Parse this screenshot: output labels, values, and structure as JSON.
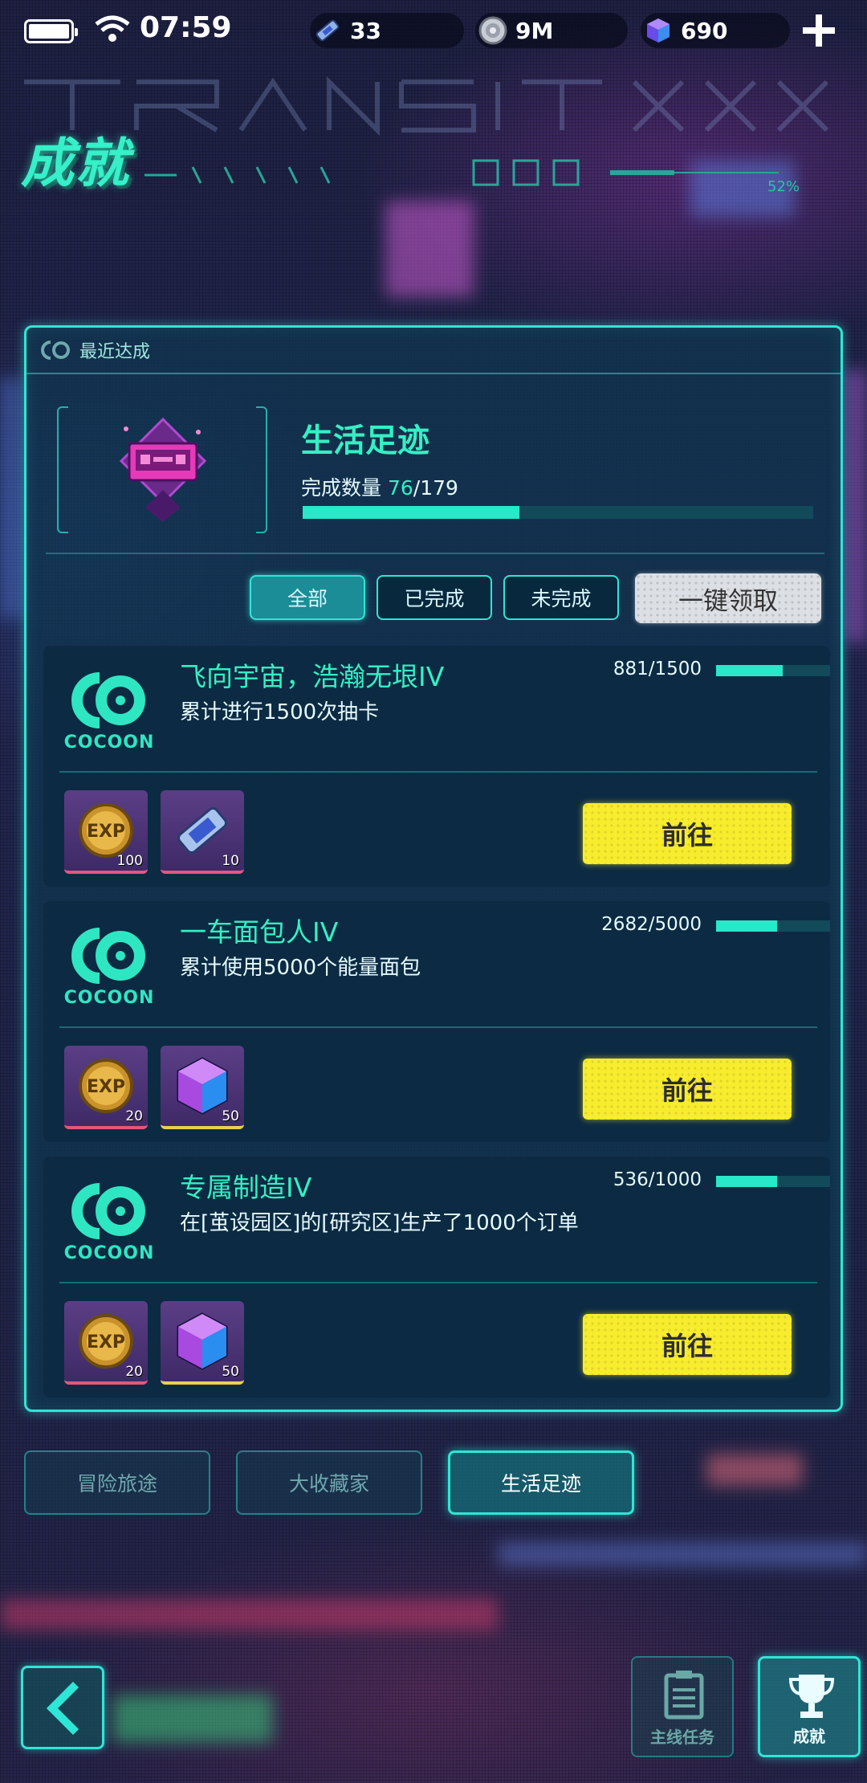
{
  "status": {
    "time": "07:59"
  },
  "resources": [
    {
      "icon": "ticket-icon",
      "value": "33"
    },
    {
      "icon": "coin-disc-icon",
      "value": "9M"
    },
    {
      "icon": "gem-cube-icon",
      "value": "690"
    }
  ],
  "header": {
    "title": "成就",
    "percent": "52%"
  },
  "panel": {
    "tab_label": "最近达成",
    "category_title": "生活足迹",
    "progress_label": "完成数量",
    "progress_done": "76",
    "progress_total": "/179",
    "progress_fraction": 0.4246
  },
  "filters": {
    "all": "全部",
    "done": "已完成",
    "undone": "未完成",
    "claim_all": "一键领取"
  },
  "achievements": [
    {
      "title": "飞向宇宙，浩瀚无垠IV",
      "desc": "累计进行1500次抽卡",
      "count": "881/1500",
      "fraction": 0.587,
      "brand": "COCOON",
      "rewards": [
        {
          "icon": "exp-coin-icon",
          "qty": "100"
        },
        {
          "icon": "ticket-icon",
          "qty": "10"
        }
      ],
      "button": "前往"
    },
    {
      "title": "一车面包人IV",
      "desc": "累计使用5000个能量面包",
      "count": "2682/5000",
      "fraction": 0.536,
      "brand": "COCOON",
      "rewards": [
        {
          "icon": "exp-coin-icon",
          "qty": "20"
        },
        {
          "icon": "gem-cube-icon",
          "qty": "50"
        }
      ],
      "button": "前往"
    },
    {
      "title": "专属制造IV",
      "desc": "在[茧设园区]的[研究区]生产了1000个订单",
      "count": "536/1000",
      "fraction": 0.536,
      "brand": "COCOON",
      "rewards": [
        {
          "icon": "exp-coin-icon",
          "qty": "20"
        },
        {
          "icon": "gem-cube-icon",
          "qty": "50"
        }
      ],
      "button": "前往"
    }
  ],
  "category_tabs": [
    {
      "label": "冒险旅途",
      "active": false
    },
    {
      "label": "大收藏家",
      "active": false
    },
    {
      "label": "生活足迹",
      "active": true
    }
  ],
  "bottom_nav": {
    "main_quest": "主线任务",
    "achievements": "成就"
  },
  "colors": {
    "accent": "#2ee6d5",
    "title_green": "#34f0c4",
    "go_yellow": "#f8ec2e",
    "bg": "#1f2448"
  }
}
